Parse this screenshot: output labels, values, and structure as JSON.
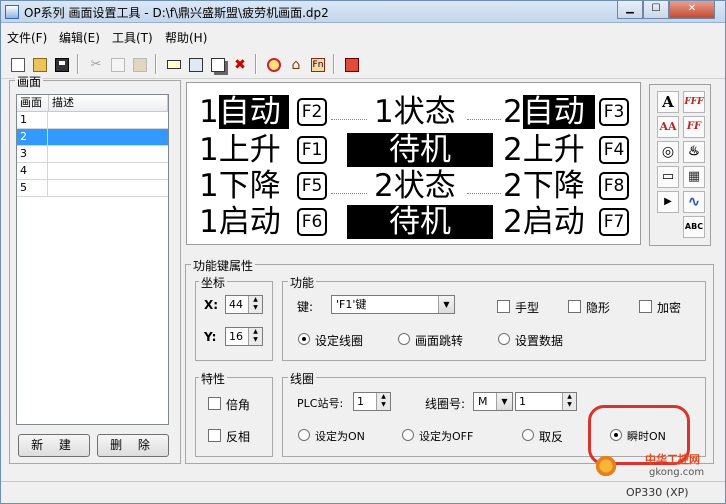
{
  "window": {
    "title": "OP系列 画面设置工具 - D:\\f\\鼎兴盛斯盟\\疲劳机画面.dp2"
  },
  "menu": [
    "文件(F)",
    "编辑(E)",
    "工具(T)",
    "帮助(H)"
  ],
  "toolbar": [
    {
      "icon": "new-file-icon"
    },
    {
      "icon": "open-folder-icon"
    },
    {
      "icon": "save-icon"
    },
    {
      "icon": "cut-icon"
    },
    {
      "icon": "copy-icon"
    },
    {
      "icon": "paste-icon"
    },
    {
      "icon": "new-screen-icon"
    },
    {
      "icon": "screen-props-icon"
    },
    {
      "icon": "copy-screen-icon"
    },
    {
      "icon": "delete-screen-icon"
    },
    {
      "icon": "alarm-icon"
    },
    {
      "icon": "home-icon"
    },
    {
      "icon": "function-key-icon"
    },
    {
      "icon": "download-icon"
    }
  ],
  "screens_panel": {
    "caption": "画面",
    "col_screen": "画面",
    "col_desc": "描述",
    "rows": [
      {
        "id": "1",
        "desc": ""
      },
      {
        "id": "2",
        "desc": "",
        "selected": true
      },
      {
        "id": "3",
        "desc": ""
      },
      {
        "id": "4",
        "desc": ""
      },
      {
        "id": "5",
        "desc": ""
      }
    ],
    "new_button": "新 建",
    "delete_button": "删 除"
  },
  "lcd": {
    "r1": {
      "a": "1自动",
      "ak": "F2",
      "b": "1状态",
      "c": "2自动",
      "ck": "F3"
    },
    "r2": {
      "a": "1上升",
      "ak": "F1",
      "b": "待机",
      "c": "2上升",
      "ck": "F4"
    },
    "r3": {
      "a": "1下降",
      "ak": "F5",
      "b": "2状态",
      "c": "2下降",
      "ck": "F8"
    },
    "r4": {
      "a": "1启动",
      "ak": "F6",
      "b": "待机",
      "c": "2启动",
      "ck": "F7"
    }
  },
  "palette": [
    {
      "icon": "text-icon",
      "label": "A"
    },
    {
      "icon": "font-icon",
      "label": "FFF"
    },
    {
      "icon": "text-size-icon",
      "label": "AA"
    },
    {
      "icon": "font-style-icon",
      "label": "FF"
    },
    {
      "icon": "lamp-icon",
      "label": "◎"
    },
    {
      "icon": "switch-icon",
      "label": "♨"
    },
    {
      "icon": "numeric-display-icon",
      "label": "▭"
    },
    {
      "icon": "bar-graph-icon",
      "label": "▦"
    },
    {
      "icon": "button-icon",
      "label": "▶"
    },
    {
      "icon": "trend-icon",
      "label": "∿"
    },
    {
      "icon": "abc-text-icon",
      "label": "ABC"
    }
  ],
  "props": {
    "caption": "功能键属性",
    "coord": {
      "caption": "坐标",
      "x_label": "X:",
      "x_value": "44",
      "y_label": "Y:",
      "y_value": "16"
    },
    "func": {
      "caption": "功能",
      "key_label": "键:",
      "key_value": "'F1'键",
      "hand": "手型",
      "hidden": "隐形",
      "encrypt": "加密",
      "set_coil": "设定线圈",
      "jump": "画面跳转",
      "set_data": "设置数据"
    },
    "feature": {
      "caption": "特性",
      "double": "倍角",
      "inverse": "反相"
    },
    "coil": {
      "caption": "线圈",
      "plc_label": "PLC站号:",
      "plc_value": "1",
      "coil_label": "线圈号:",
      "coil_type": "M",
      "coil_value": "1",
      "set_on": "设定为ON",
      "set_off": "设定为OFF",
      "toggle": "取反",
      "momentary": "瞬时ON"
    }
  },
  "status": {
    "text": "OP330 (XP)"
  },
  "watermark": {
    "line1": "中华工控网",
    "line2": "gkong.com"
  }
}
